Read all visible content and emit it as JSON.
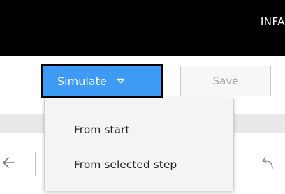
{
  "header": {
    "brand": "INFA"
  },
  "toolbar": {
    "simulate_label": "Simulate",
    "save_label": "Save"
  },
  "simulate_menu": {
    "items": [
      {
        "label": "From start"
      },
      {
        "label": "From selected step"
      }
    ]
  },
  "colors": {
    "topbar": "#000000",
    "simulate_button": "#3d9bf5",
    "menu_background": "#f4f4f4",
    "save_disabled_text": "#a3a3a3"
  },
  "icons": {
    "simulate_caret": "chevron-down-icon",
    "back": "arrow-left-icon",
    "redo": "redo-icon"
  }
}
